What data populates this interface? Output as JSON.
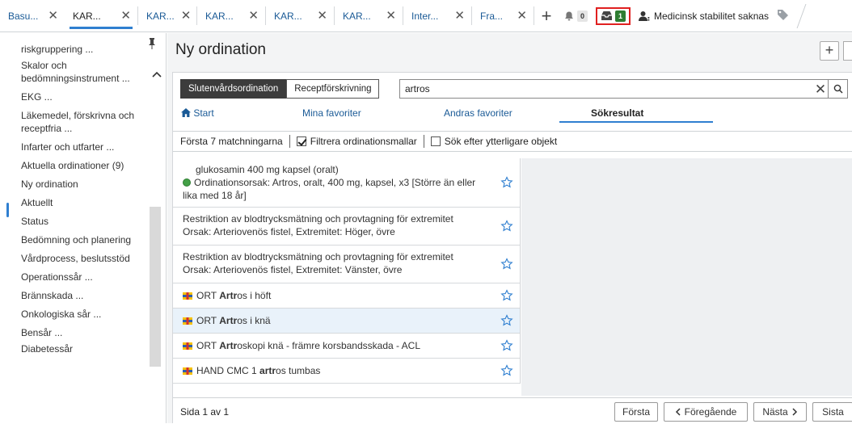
{
  "tabs": [
    {
      "label": "Basu...",
      "active": false
    },
    {
      "label": "KAR...",
      "active": true
    },
    {
      "label": "KAR...",
      "active": false
    },
    {
      "label": "KAR...",
      "active": false
    },
    {
      "label": "KAR...",
      "active": false
    },
    {
      "label": "KAR...",
      "active": false
    },
    {
      "label": "Inter...",
      "active": false
    },
    {
      "label": "Fra...",
      "active": false
    }
  ],
  "topbar": {
    "notifications_count": "0",
    "inbox_count": "1",
    "warning_text": "Medicinsk stabilitet saknas"
  },
  "sidebar": {
    "items": [
      "riskgruppering ...",
      "Skalor och bedömningsinstrument ...",
      "EKG ...",
      "Läkemedel, förskrivna och receptfria ...",
      "Infarter och utfarter ...",
      "Aktuella ordinationer (9)",
      "Ny ordination",
      "Aktuellt",
      "Status",
      "Bedömning och planering",
      "Vårdprocess, beslutsstöd",
      "Operationssår ...",
      "Brännskada ...",
      "Onkologiska sår ...",
      "Bensår ...",
      "Diabetessår"
    ],
    "selected": "Ny ordination"
  },
  "main": {
    "title": "Ny ordination",
    "mode_buttons": [
      "Slutenvårdsordination",
      "Receptförskrivning"
    ],
    "search_value": "artros",
    "nav_tabs": [
      "Start",
      "Mina favoriter",
      "Andras favoriter",
      "Sökresultat"
    ],
    "filter": {
      "count_label": "Första 7 matchningarna",
      "filter_templates_label": "Filtrera ordinationsmallar",
      "filter_templates_checked": true,
      "search_more_label": "Sök efter ytterligare objekt",
      "search_more_checked": false
    },
    "results": [
      {
        "line1": "glukosamin 400 mg kapsel (oralt)",
        "line2": "Ordinationsorsak: Artros, oralt, 400 mg, kapsel, x3 [Större än eller lika med 18 år]"
      },
      {
        "line1": "Restriktion av blodtrycksmätning och provtagning för extremitet",
        "line2": "Orsak: Arteriovenös fistel, Extremitet: Höger, övre"
      },
      {
        "line1": "Restriktion av blodtrycksmätning och provtagning för extremitet",
        "line2": "Orsak: Arteriovenös fistel, Extremitet: Vänster, övre"
      },
      {
        "pre": "ORT ",
        "bold": "Artr",
        "post": "os i höft"
      },
      {
        "pre": "ORT ",
        "bold": "Artr",
        "post": "os i knä"
      },
      {
        "pre": "ORT ",
        "bold": "Artr",
        "post": "oskopi knä - främre korsbandsskada - ACL"
      },
      {
        "pre": "HAND CMC 1 ",
        "bold": "artr",
        "post": "os tumbas"
      }
    ],
    "pager": {
      "page_text": "Sida 1 av 1",
      "first": "Första",
      "prev": "Föregående",
      "next": "Nästa",
      "last": "Sista"
    }
  },
  "colors": {
    "accent": "#2f7fd0",
    "link": "#1a5a96",
    "success": "#2e7d32",
    "highlight": "#e02020"
  }
}
